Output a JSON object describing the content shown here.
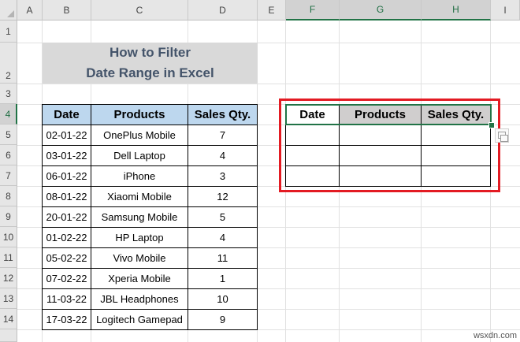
{
  "columns": [
    "A",
    "B",
    "C",
    "D",
    "E",
    "F",
    "G",
    "H",
    "I"
  ],
  "rows": [
    "1",
    "2",
    "3",
    "4",
    "5",
    "6",
    "7",
    "8",
    "9",
    "10",
    "11",
    "12",
    "13",
    "14"
  ],
  "title": {
    "line1": "How to Filter",
    "line2": "Date Range in Excel"
  },
  "table1": {
    "headers": [
      "Date",
      "Products",
      "Sales Qty."
    ],
    "rows": [
      [
        "02-01-22",
        "OnePlus Mobile",
        "7"
      ],
      [
        "03-01-22",
        "Dell Laptop",
        "4"
      ],
      [
        "06-01-22",
        "iPhone",
        "3"
      ],
      [
        "08-01-22",
        "Xiaomi Mobile",
        "12"
      ],
      [
        "20-01-22",
        "Samsung Mobile",
        "5"
      ],
      [
        "01-02-22",
        "HP Laptop",
        "4"
      ],
      [
        "05-02-22",
        "Vivo Mobile",
        "11"
      ],
      [
        "07-02-22",
        "Xperia Mobile",
        "1"
      ],
      [
        "11-03-22",
        "JBL Headphones",
        "10"
      ],
      [
        "17-03-22",
        "Logitech Gamepad",
        "9"
      ]
    ]
  },
  "table2": {
    "headers": [
      "Date",
      "Products",
      "Sales Qty."
    ]
  },
  "watermark": "wsxdn.com",
  "colors": {
    "header_blue": "#bdd7ee",
    "header_gray": "#d0cece",
    "title_text": "#44546a",
    "highlight_red": "#e31b23",
    "excel_green": "#217346"
  }
}
